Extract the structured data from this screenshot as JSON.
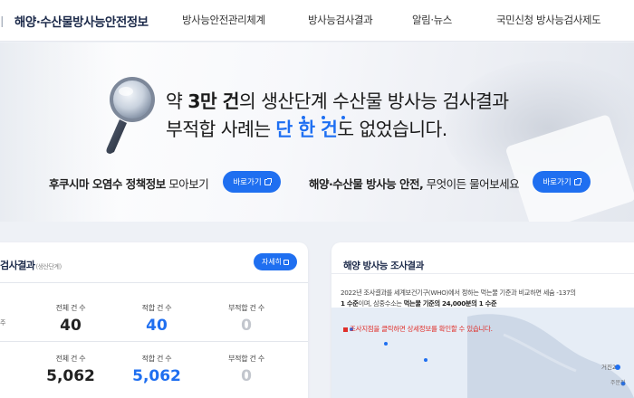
{
  "header": {
    "brand": "해양·수산물방사능안전정보",
    "brand_prefix": "ㅣ",
    "nav": [
      "방사능안전관리체계",
      "방사능검사결과",
      "알림·뉴스",
      "국민신청 방사능검사제도"
    ]
  },
  "hero": {
    "headline_line1_a": "약 ",
    "headline_line1_b": "3만 건",
    "headline_line1_c": "의 생산단계 수산물 방사능 검사결과",
    "headline_line2_a": "부적합 사례는 ",
    "headline_line2_b": "단 한 건",
    "headline_line2_c": "도 없었습니다.",
    "link1_bold": "후쿠시마 오염수 정책정보",
    "link1_rest": " 모아보기",
    "link2_bold": "해양·수산물 방사능 안전,",
    "link2_rest": " 무엇이든 물어보세요",
    "go_label": "바로가기"
  },
  "left_panel": {
    "title": "검사결과",
    "subtitle": "(생산단계)",
    "detail_label": "자세히",
    "row1_stub": "주",
    "rows": [
      {
        "total_label": "전체 건 수",
        "total": "40",
        "pass_label": "적합 건 수",
        "pass": "40",
        "fail_label": "부적합 건 수",
        "fail": "0"
      },
      {
        "total_label": "전체 건 수",
        "total": "5,062",
        "pass_label": "적합 건 수",
        "pass": "5,062",
        "fail_label": "부적합 건 수",
        "fail": "0"
      }
    ]
  },
  "right_panel": {
    "title": "해양 방사능 조사결과",
    "line1": "2022년 조사결과를 세계보건기구(WHO)에서 정하는 먹는물 기준과 비교하면 세슘 -137의",
    "line2_bold_a": "1 수준",
    "line2_mid": "이며, 삼중수소는 ",
    "line2_bold_b": "먹는물 기준의 24,000분의 1 수준",
    "note": "조사지점을 클릭하면 상세정보를 확인할 수 있습니다.",
    "map_label": "거진2",
    "map_label2": "주문진"
  },
  "colors": {
    "accent": "#1f6ff0",
    "highlight": "#1e6ff2",
    "note_red": "#e0302b",
    "map_sea": "#e3ecf6",
    "map_land": "#c5d2e4"
  },
  "icons": [
    "external-link-icon",
    "magnifier-icon"
  ]
}
